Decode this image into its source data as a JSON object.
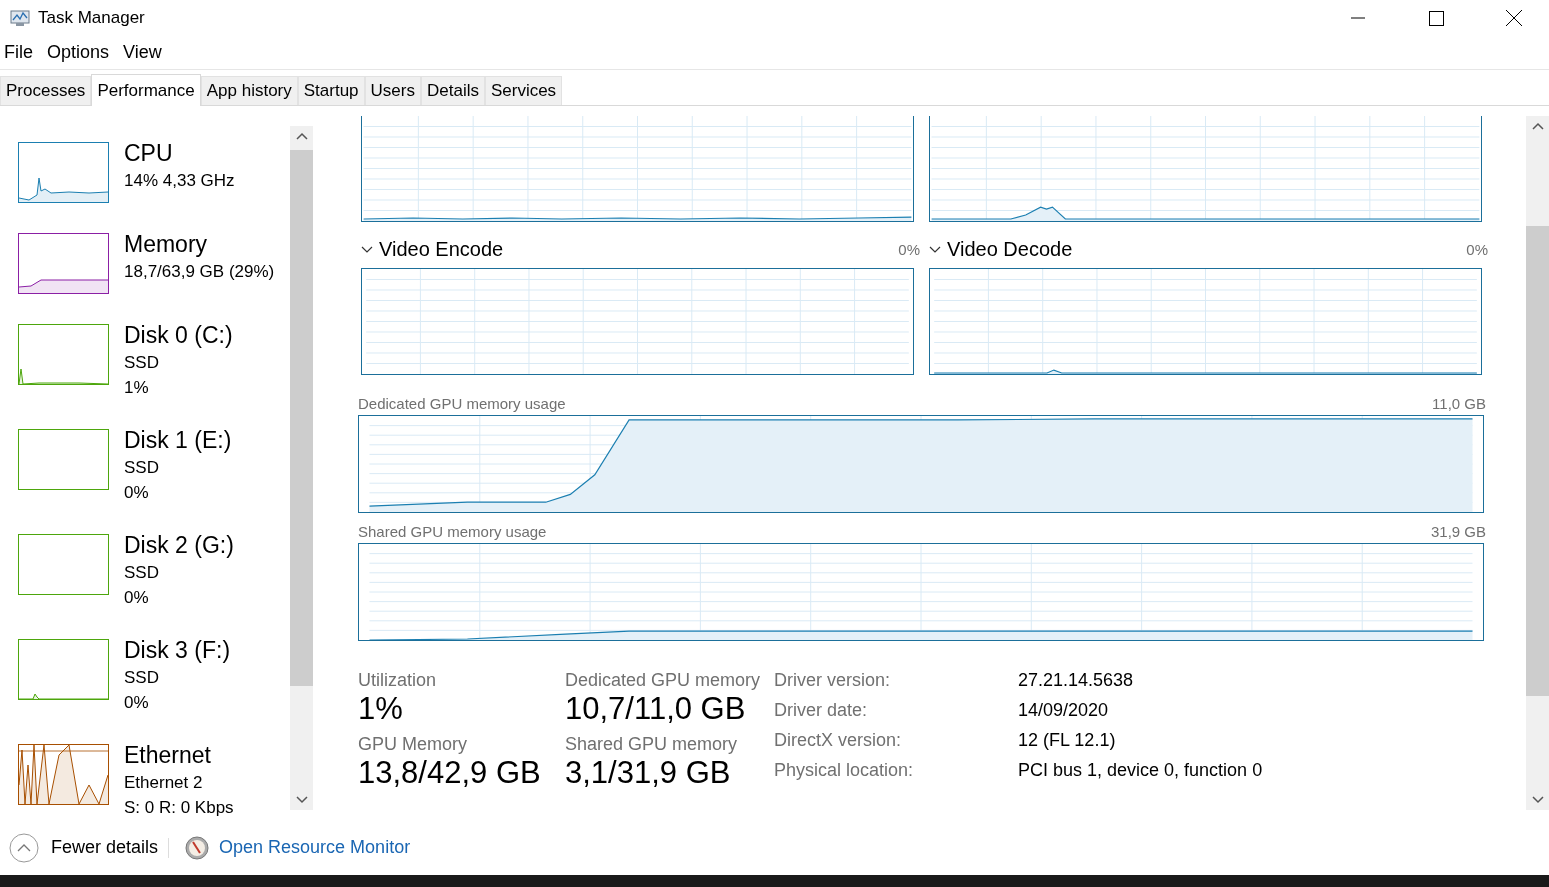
{
  "window": {
    "title": "Task Manager"
  },
  "menu": [
    "File",
    "Options",
    "View"
  ],
  "tabs": [
    {
      "label": "Processes",
      "selected": false
    },
    {
      "label": "Performance",
      "selected": true
    },
    {
      "label": "App history",
      "selected": false
    },
    {
      "label": "Startup",
      "selected": false
    },
    {
      "label": "Users",
      "selected": false
    },
    {
      "label": "Details",
      "selected": false
    },
    {
      "label": "Services",
      "selected": false
    }
  ],
  "sidebar": {
    "items": [
      {
        "kind": "cpu",
        "title": "CPU",
        "lines": [
          "14%  4,33 GHz"
        ],
        "color": "#1b7fb1",
        "selected": false
      },
      {
        "kind": "memory",
        "title": "Memory",
        "lines": [
          "18,7/63,9 GB (29%)"
        ],
        "color": "#8b1fa5",
        "selected": false
      },
      {
        "kind": "disk",
        "title": "Disk 0 (C:)",
        "lines": [
          "SSD",
          "1%"
        ],
        "color": "#4da60c",
        "selected": false
      },
      {
        "kind": "disk",
        "title": "Disk 1 (E:)",
        "lines": [
          "SSD",
          "0%"
        ],
        "color": "#4da60c",
        "selected": false
      },
      {
        "kind": "disk",
        "title": "Disk 2 (G:)",
        "lines": [
          "SSD",
          "0%"
        ],
        "color": "#4da60c",
        "selected": false
      },
      {
        "kind": "disk",
        "title": "Disk 3 (F:)",
        "lines": [
          "SSD",
          "0%"
        ],
        "color": "#4da60c",
        "selected": false
      },
      {
        "kind": "ethernet",
        "title": "Ethernet",
        "lines": [
          "Ethernet 2",
          "S: 0  R: 0 Kbps"
        ],
        "color": "#a74f01",
        "selected": false
      }
    ]
  },
  "engines": [
    {
      "name": "Video Encode",
      "reading": "0%",
      "expanded": true
    },
    {
      "name": "Video Decode",
      "reading": "0%",
      "expanded": true
    }
  ],
  "memory_graphs": [
    {
      "label": "Dedicated GPU memory usage",
      "max": "11,0 GB"
    },
    {
      "label": "Shared GPU memory usage",
      "max": "31,9 GB"
    }
  ],
  "stats": [
    {
      "label": "Utilization",
      "value": "1%"
    },
    {
      "label": "Dedicated GPU memory",
      "value": "10,7/11,0 GB"
    },
    {
      "label": "GPU Memory",
      "value": "13,8/42,9 GB"
    },
    {
      "label": "Shared GPU memory",
      "value": "3,1/31,9 GB"
    }
  ],
  "details": [
    {
      "label": "Driver version:",
      "value": "27.21.14.5638"
    },
    {
      "label": "Driver date:",
      "value": "14/09/2020"
    },
    {
      "label": "DirectX version:",
      "value": "12 (FL 12.1)"
    },
    {
      "label": "Physical location:",
      "value": "PCI bus 1, device 0, function 0"
    }
  ],
  "footer": {
    "toggle": "Fewer details",
    "link": "Open Resource Monitor"
  }
}
